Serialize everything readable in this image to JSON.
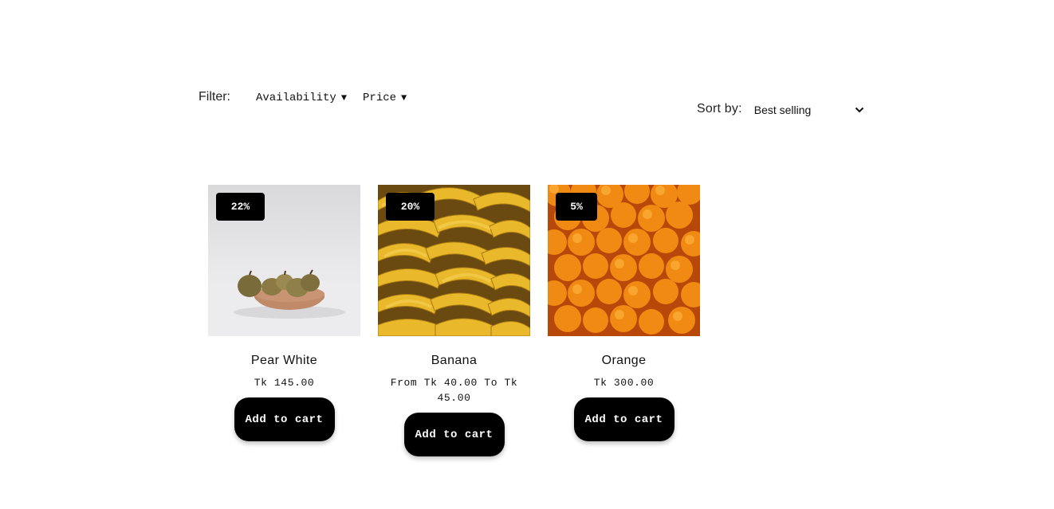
{
  "filter": {
    "label": "Filter:",
    "availability_label": "Availability",
    "price_label": "Price",
    "caret_icon": "caret-down-icon"
  },
  "sort": {
    "label": "Sort by:",
    "selected": "Best selling",
    "chevron_icon": "chevron-down-icon"
  },
  "products": [
    {
      "title": "Pear White",
      "price": "Tk 145.00",
      "badge": "22%",
      "button": "Add to cart",
      "image": "pear-image"
    },
    {
      "title": "Banana",
      "price": "From Tk 40.00 To Tk 45.00",
      "badge": "20%",
      "button": "Add to cart",
      "image": "banana-image"
    },
    {
      "title": "Orange",
      "price": "Tk 300.00",
      "badge": "5%",
      "button": "Add to cart",
      "image": "orange-image"
    }
  ],
  "colors": {
    "button_bg": "#000000",
    "button_text": "#ffffff",
    "badge_bg": "#000000"
  }
}
